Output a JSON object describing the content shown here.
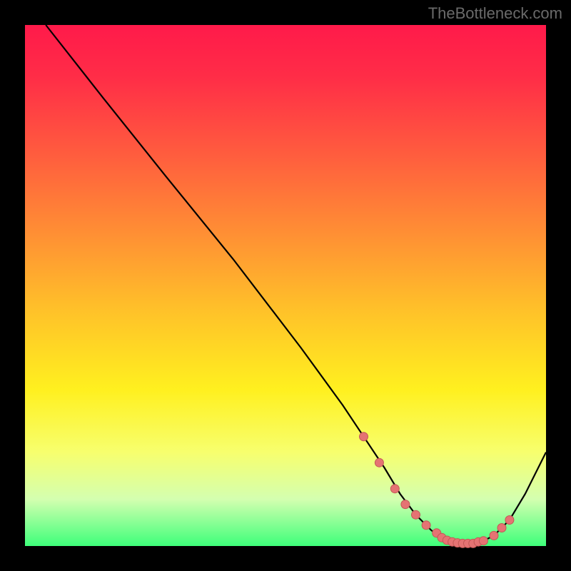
{
  "watermark": "TheBottleneck.com",
  "colors": {
    "background": "#000000",
    "curve_stroke": "#000000",
    "marker_fill": "#e57373",
    "marker_stroke": "#c25855"
  },
  "chart_data": {
    "type": "line",
    "title": "",
    "xlabel": "",
    "ylabel": "",
    "xlim": [
      0,
      100
    ],
    "ylim": [
      0,
      100
    ],
    "series": [
      {
        "name": "bottleneck-curve",
        "x": [
          4,
          15,
          27,
          40,
          53,
          61,
          65,
          69,
          72,
          75,
          78,
          80,
          82,
          84,
          86,
          88,
          90,
          93,
          96,
          100
        ],
        "y": [
          100,
          86,
          71,
          55,
          38,
          27,
          21,
          15,
          10,
          6,
          3,
          1.5,
          0.8,
          0.5,
          0.5,
          1,
          2,
          5,
          10,
          18
        ]
      }
    ],
    "markers": {
      "name": "trough-markers",
      "x": [
        65,
        68,
        71,
        73,
        75,
        77,
        79,
        80,
        81,
        82,
        83,
        84,
        85,
        86,
        87,
        88,
        90,
        91.5,
        93
      ],
      "y": [
        21,
        16,
        11,
        8,
        6,
        4,
        2.5,
        1.6,
        1.1,
        0.8,
        0.6,
        0.5,
        0.5,
        0.5,
        0.8,
        1,
        2,
        3.5,
        5
      ]
    }
  }
}
